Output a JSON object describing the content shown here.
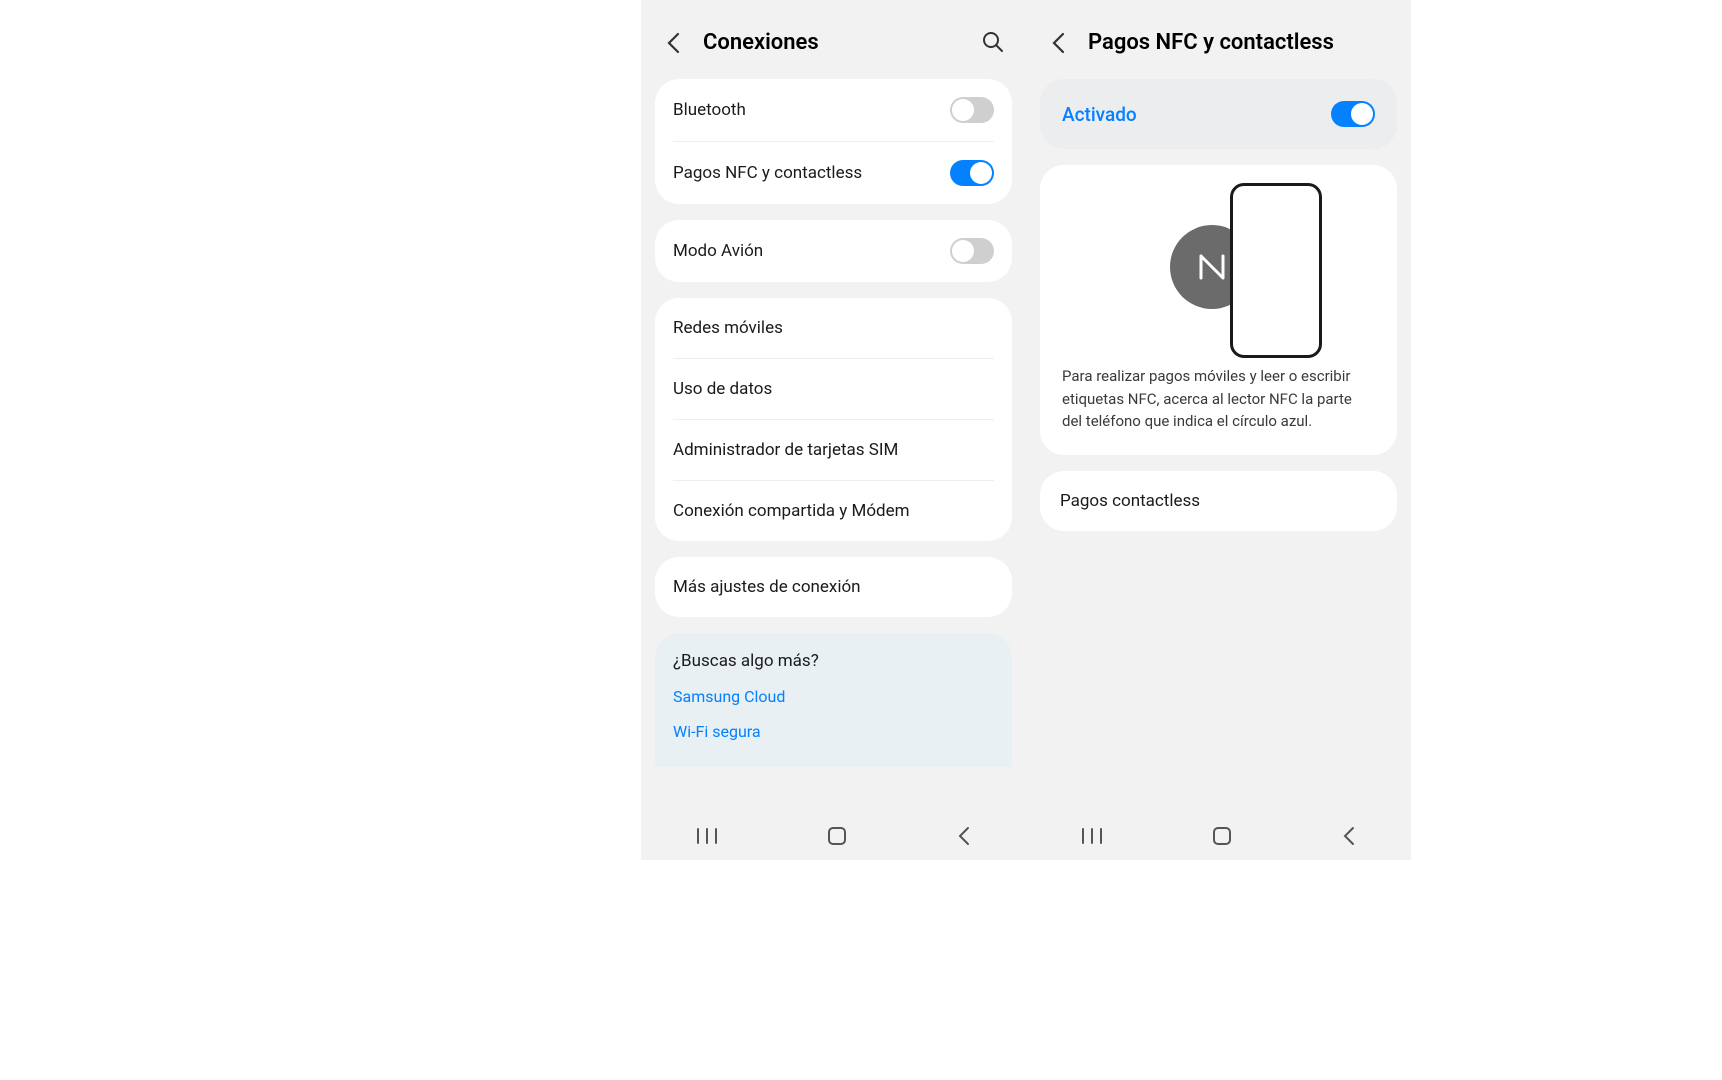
{
  "left": {
    "title": "Conexiones",
    "groups": [
      {
        "items": [
          {
            "label": "Bluetooth",
            "toggle": "off"
          },
          {
            "label": "Pagos NFC y contactless",
            "toggle": "on"
          }
        ]
      },
      {
        "items": [
          {
            "label": "Modo Avión",
            "toggle": "off"
          }
        ]
      },
      {
        "items": [
          {
            "label": "Redes móviles"
          },
          {
            "label": "Uso de datos"
          },
          {
            "label": "Administrador de tarjetas SIM"
          },
          {
            "label": "Conexión compartida y Módem"
          }
        ]
      },
      {
        "items": [
          {
            "label": "Más ajustes de conexión"
          }
        ]
      }
    ],
    "search_more": {
      "title": "¿Buscas algo más?",
      "links": [
        "Samsung Cloud",
        "Wi-Fi segura"
      ]
    }
  },
  "right": {
    "title": "Pagos NFC y contactless",
    "activated_label": "Activado",
    "activated_toggle": "on",
    "nfc_description": "Para realizar pagos móviles y leer o escribir etiquetas NFC, acerca al lector NFC la parte del teléfono que indica el círculo azul.",
    "contactless_label": "Pagos contactless"
  },
  "colors": {
    "accent": "#0381fe"
  }
}
